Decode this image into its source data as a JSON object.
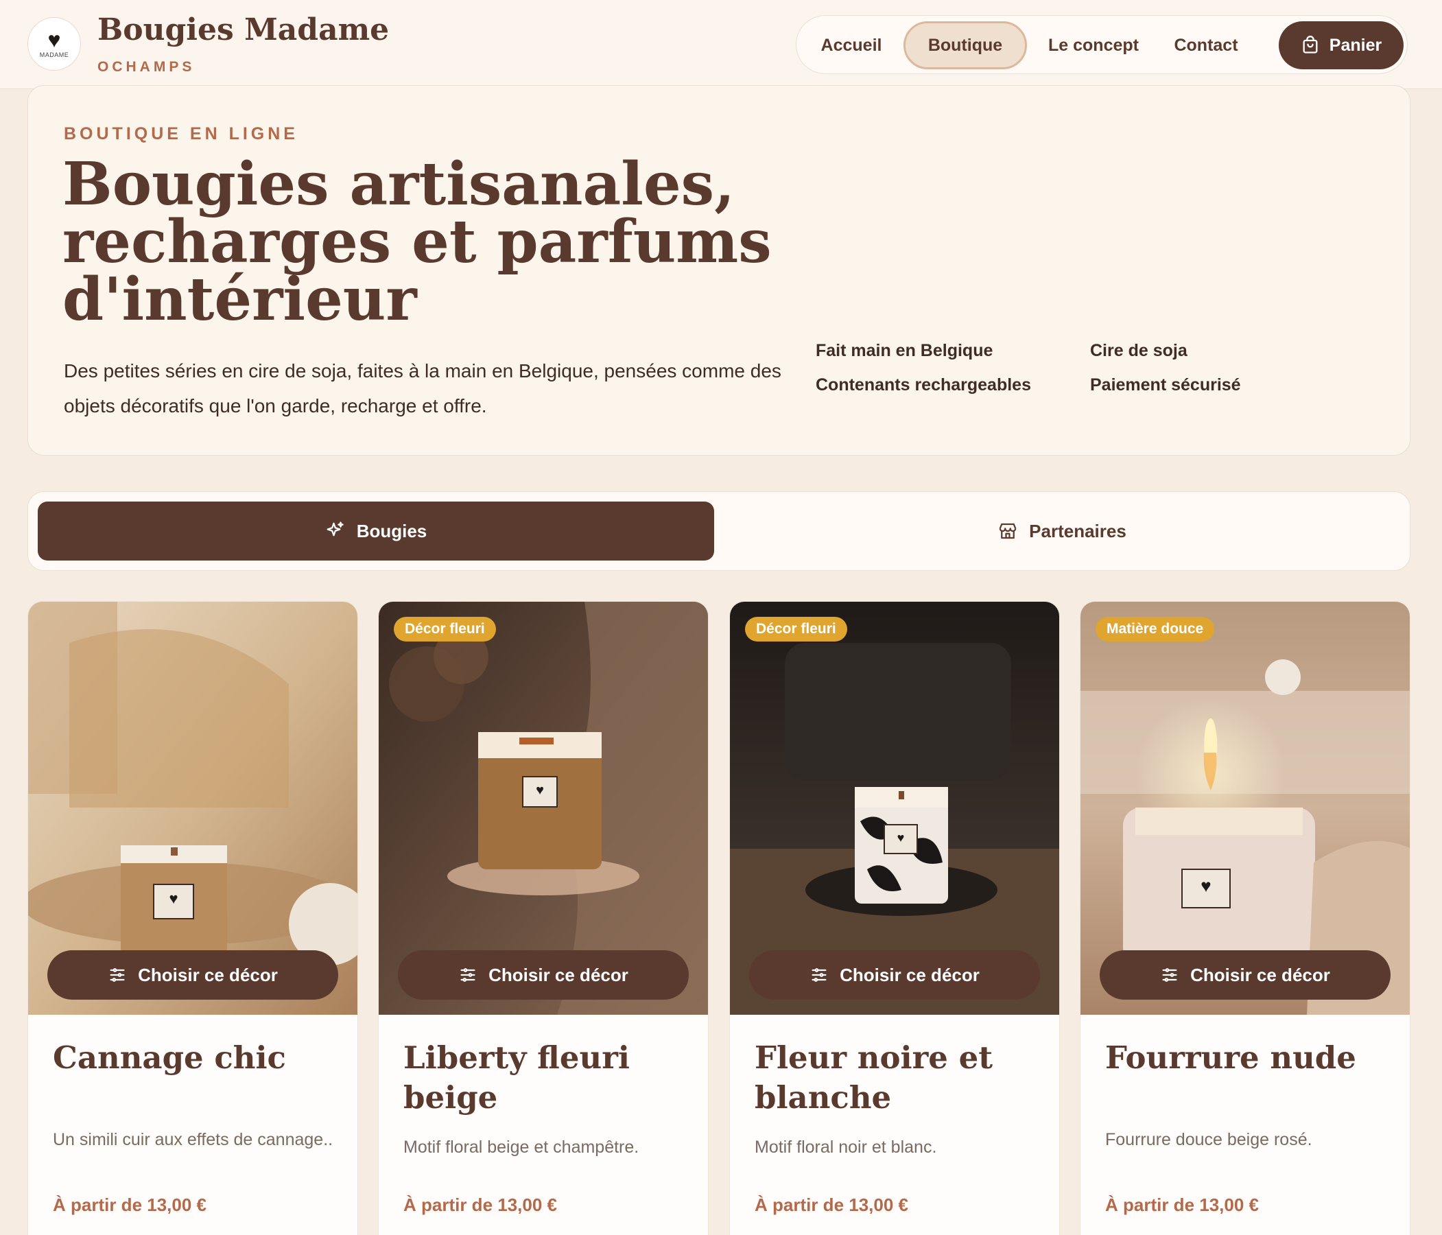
{
  "header": {
    "logo_text": "MADAME",
    "brand_name": "Bougies Madame",
    "brand_sub": "OCHAMPS",
    "nav": [
      {
        "label": "Accueil"
      },
      {
        "label": "Boutique"
      },
      {
        "label": "Le concept"
      },
      {
        "label": "Contact"
      }
    ],
    "cart_label": "Panier"
  },
  "hero": {
    "eyebrow": "BOUTIQUE EN LIGNE",
    "title_line1": "Bougies artisanales,",
    "title_line2": "recharges et parfums",
    "title_line3": "d'intérieur",
    "description": "Des petites séries en cire de soja, faites à la main en Belgique, pensées comme des objets décoratifs que l'on garde, recharge et offre.",
    "features": [
      "Fait main en Belgique",
      "Cire de soja",
      "Contenants rechargeables",
      "Paiement sécurisé"
    ]
  },
  "tabs": {
    "bougies": "Bougies",
    "partenaires": "Partenaires"
  },
  "products": [
    {
      "badge": "",
      "button": "Choisir ce décor",
      "title": "Cannage chic",
      "description": "Un simili cuir aux effets de cannage..",
      "price": "À partir de 13,00 €"
    },
    {
      "badge": "Décor fleuri",
      "button": "Choisir ce décor",
      "title": "Liberty fleuri beige",
      "description": "Motif floral beige et champêtre.",
      "price": "À partir de 13,00 €"
    },
    {
      "badge": "Décor fleuri",
      "button": "Choisir ce décor",
      "title": "Fleur noire et blanche",
      "description": "Motif floral noir et blanc.",
      "price": "À partir de 13,00 €"
    },
    {
      "badge": "Matière douce",
      "button": "Choisir ce décor",
      "title": "Fourrure nude",
      "description": "Fourrure douce beige rosé.",
      "price": "À partir de 13,00 €"
    }
  ],
  "colors": {
    "brand_brown": "#5a3a2e",
    "accent_terracotta": "#b3694a",
    "badge_gold": "#e0a52e",
    "background": "#f6ece1"
  }
}
